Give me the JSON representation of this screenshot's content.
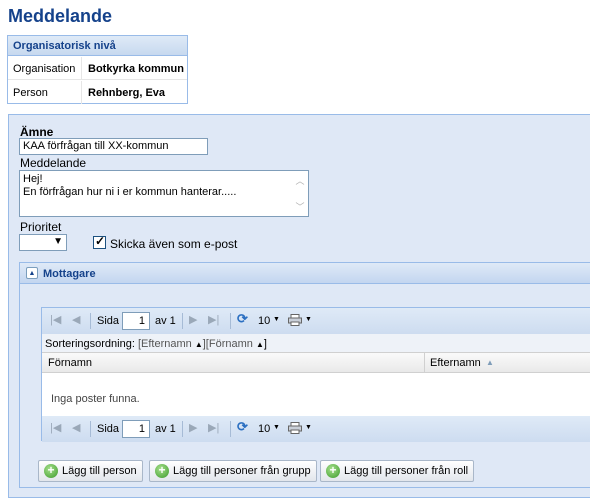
{
  "page": {
    "title": "Meddelande"
  },
  "org": {
    "header": "Organisatorisk nivå",
    "rows": [
      {
        "key": "Organisation",
        "value": "Botkyrka kommun"
      },
      {
        "key": "Person",
        "value": "Rehnberg, Eva"
      }
    ]
  },
  "form": {
    "subject_label": "Ämne",
    "subject_value": "KAA förfrågan till XX-kommun",
    "message_label": "Meddelande",
    "message_line1": "Hej!",
    "message_line2": "En förfrågan hur ni i er kommun hanterar.....",
    "priority_label": "Prioritet",
    "priority_value": "",
    "email_label": "Skicka även som e-post",
    "email_checked": true
  },
  "recipients": {
    "title": "Mottagare",
    "pager": {
      "page_label": "Sida",
      "page_value": "1",
      "of_label": "av 1",
      "page_size": "10"
    },
    "sort": {
      "label": "Sorteringsordning:",
      "item1": "[Efternamn",
      "item2": "][Förnamn",
      "end": "]"
    },
    "columns": {
      "first": "Förnamn",
      "last": "Efternamn"
    },
    "empty_text": "Inga poster funna."
  },
  "buttons": {
    "add_person": "Lägg till person",
    "add_group": "Lägg till personer från grupp",
    "add_role": "Lägg till personer från roll"
  }
}
